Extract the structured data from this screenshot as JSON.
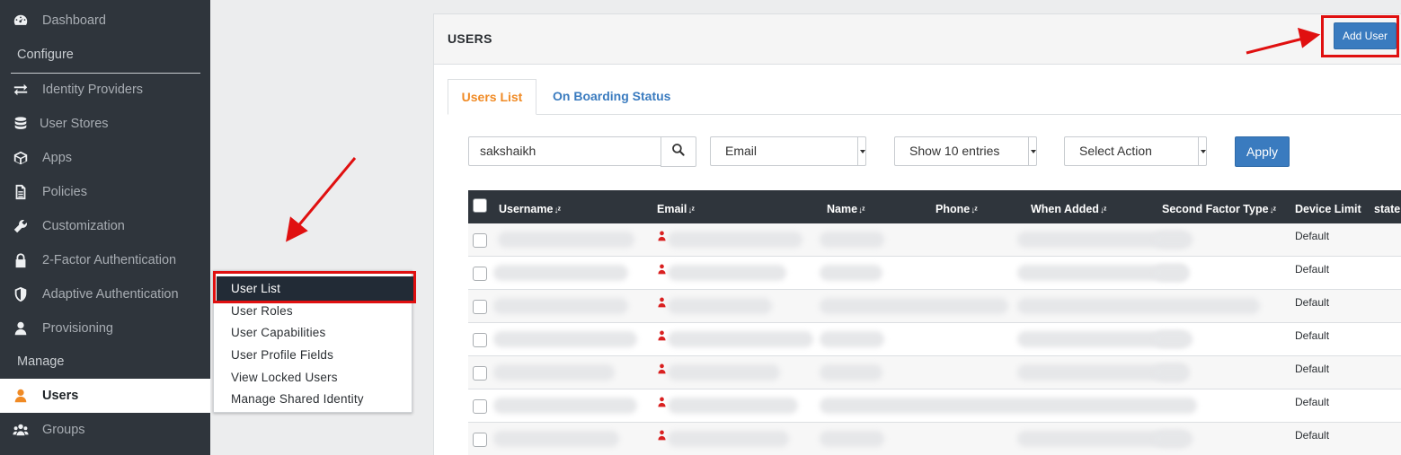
{
  "sidebar": {
    "dashboard": "Dashboard",
    "configure": "Configure",
    "items": [
      {
        "label": "Identity Providers",
        "icon": "arrows-exchange-icon"
      },
      {
        "label": "User Stores",
        "icon": "database-icon"
      },
      {
        "label": "Apps",
        "icon": "cube-icon"
      },
      {
        "label": "Policies",
        "icon": "document-icon"
      },
      {
        "label": "Customization",
        "icon": "wrench-icon"
      },
      {
        "label": "2-Factor Authentication",
        "icon": "lock-icon"
      },
      {
        "label": "Adaptive Authentication",
        "icon": "shield-icon"
      },
      {
        "label": "Provisioning",
        "icon": "user-icon"
      }
    ],
    "manage": "Manage",
    "users": "Users",
    "groups": "Groups"
  },
  "popup_menu": {
    "items": [
      "User List",
      "User Roles",
      "User Capabilities",
      "User Profile Fields",
      "View Locked Users",
      "Manage Shared Identity"
    ]
  },
  "panel": {
    "title": "USERS",
    "add_user": "Add User"
  },
  "tabs": [
    "Users List",
    "On Boarding Status"
  ],
  "filters": {
    "search_value": "sakshaikh",
    "field_select": "Email",
    "entries_select": "Show 10 entries",
    "action_select": "Select Action",
    "apply": "Apply"
  },
  "table": {
    "columns": [
      "Username",
      "Email",
      "Name",
      "Phone",
      "When Added",
      "Second Factor Type",
      "Device Limit",
      "state"
    ],
    "rows": [
      {
        "device_limit": "Default"
      },
      {
        "device_limit": "Default"
      },
      {
        "device_limit": "Default"
      },
      {
        "device_limit": "Default"
      },
      {
        "device_limit": "Default"
      },
      {
        "device_limit": "Default"
      },
      {
        "device_limit": "Default"
      }
    ]
  },
  "colors": {
    "sidebar_bg": "#2f353c",
    "accent_orange": "#f08a24",
    "primary_blue": "#3a7bbf",
    "annotation_red": "#e01010"
  }
}
